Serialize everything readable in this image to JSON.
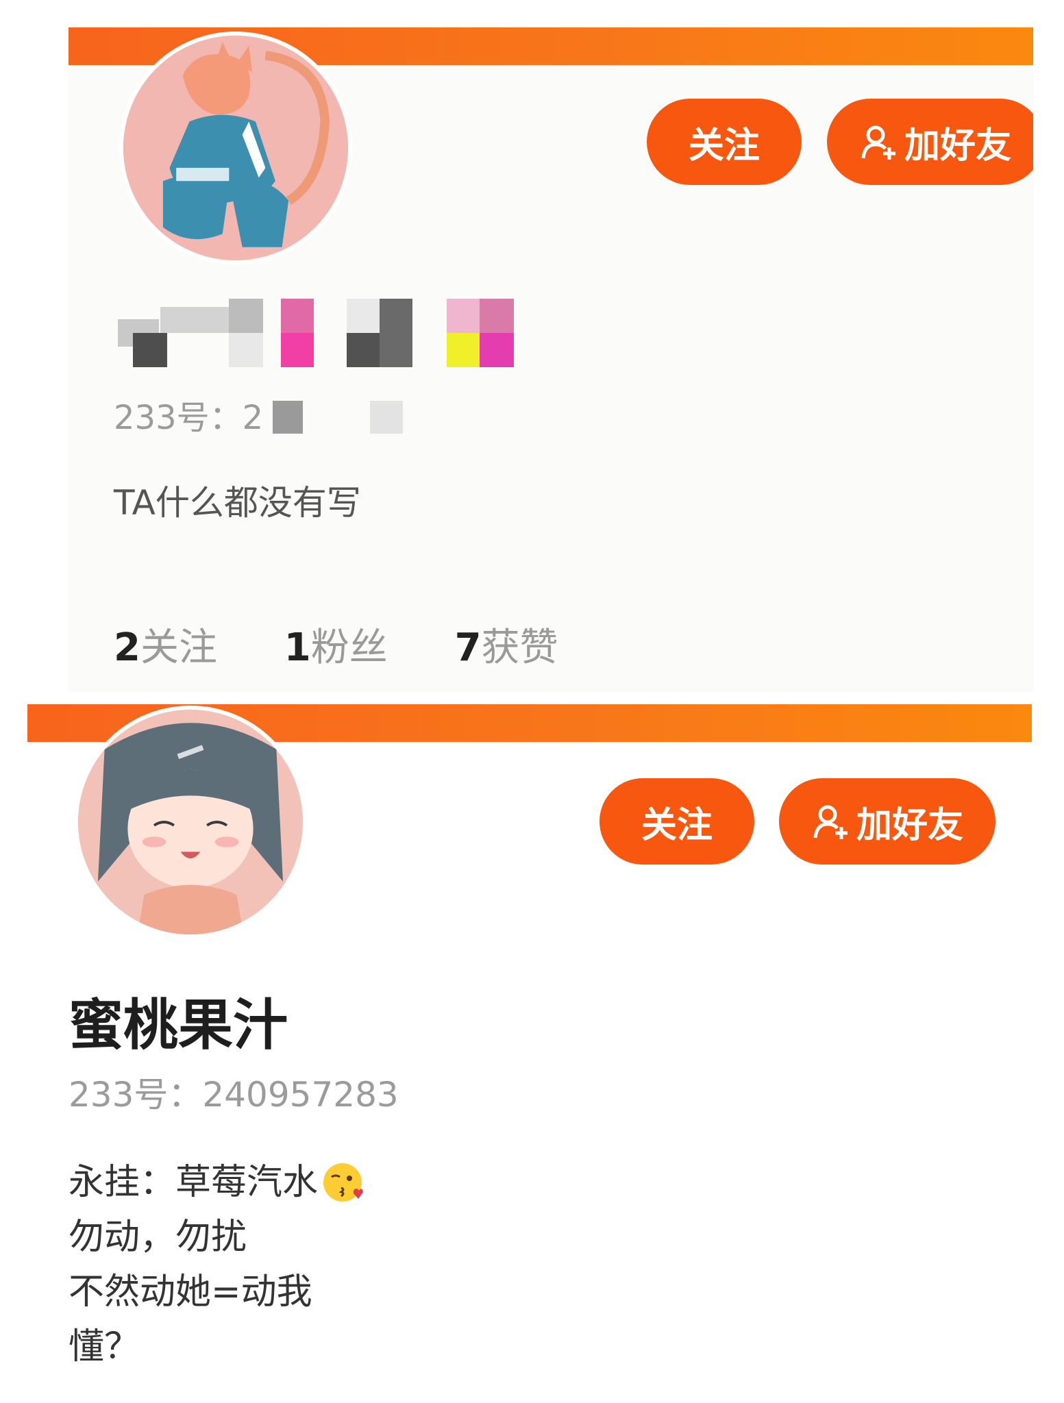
{
  "profiles": [
    {
      "buttons": {
        "follow": "关注",
        "add_friend": "加好友"
      },
      "uid_label": "233号：",
      "uid_value": "2",
      "bio": "TA什么都没有写",
      "stats": [
        {
          "num": "2",
          "label": "关注"
        },
        {
          "num": "1",
          "label": "粉丝"
        },
        {
          "num": "7",
          "label": "获赞"
        }
      ]
    },
    {
      "buttons": {
        "follow": "关注",
        "add_friend": "加好友"
      },
      "name": "蜜桃果汁",
      "uid": "233号：240957283",
      "bio_lines": [
        "永挂：草莓汽水",
        "勿动，勿扰",
        "不然动她=动我",
        "懂？"
      ]
    }
  ],
  "colors": {
    "accent": "#f8570f",
    "banner": "#f7641c"
  },
  "icons": {
    "add_friend": "user-plus-icon",
    "emoji": "kissing-face-emoji"
  }
}
